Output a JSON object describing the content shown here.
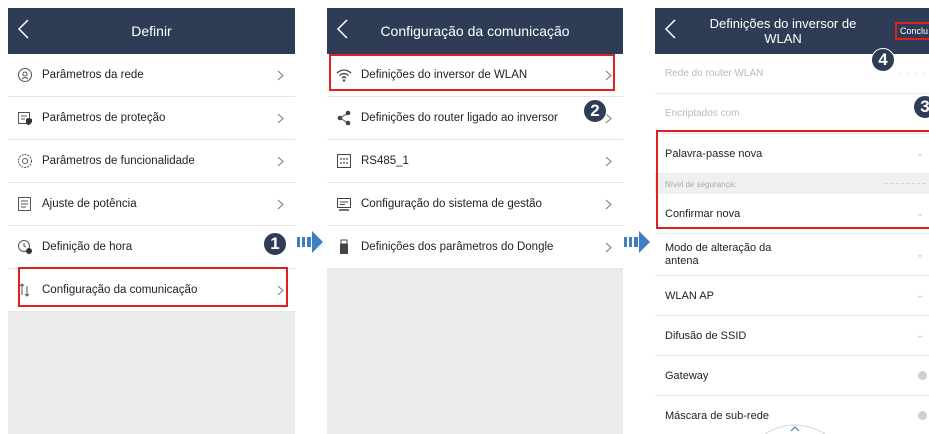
{
  "screen1": {
    "title": "Definir",
    "items": [
      {
        "label": "Parâmetros da rede",
        "icon": "network-params-icon"
      },
      {
        "label": "Parâmetros de proteção",
        "icon": "protection-params-icon"
      },
      {
        "label": "Parâmetros de funcionalidade",
        "icon": "feature-params-icon"
      },
      {
        "label": "Ajuste de potência",
        "icon": "power-adjust-icon"
      },
      {
        "label": "Definição de hora",
        "icon": "clock-settings-icon"
      },
      {
        "label": "Configuração da comunicação",
        "icon": "communication-icon"
      }
    ]
  },
  "screen2": {
    "title": "Configuração da comunicação",
    "items": [
      {
        "label": "Definições do inversor de WLAN",
        "icon": "wifi-icon"
      },
      {
        "label": "Definições do router ligado ao inversor",
        "icon": "share-icon"
      },
      {
        "label": "RS485_1",
        "icon": "rs485-icon"
      },
      {
        "label": "Configuração do sistema de gestão",
        "icon": "monitor-icon"
      },
      {
        "label": "Definições dos parâmetros do Dongle",
        "icon": "dongle-icon"
      }
    ]
  },
  "screen3": {
    "title_line1": "Definições do inversor de",
    "title_line2": "WLAN",
    "done_label": "Conclu",
    "router_network_label": "Rede do router WLAN",
    "encrypted_label": "Encriptados com",
    "new_password_label": "Palavra-passe nova",
    "security_level_label": "Nível de segurança:",
    "confirm_new_label": "Confirmar nova",
    "antenna_mode_line1": "Modo de alteração da",
    "antenna_mode_line2": "antena",
    "wlan_ap_label": "WLAN AP",
    "ssid_broadcast_label": "Difusão de SSID",
    "gateway_label": "Gateway",
    "subnet_mask_label": "Máscara de sub-rede"
  },
  "badges": {
    "b1": "1",
    "b2": "2",
    "b3": "3",
    "b4": "4"
  },
  "colors": {
    "header": "#2e3d55",
    "highlight": "#e02020",
    "arrow": "#3d7fc1",
    "badge": "#2e3d55"
  }
}
